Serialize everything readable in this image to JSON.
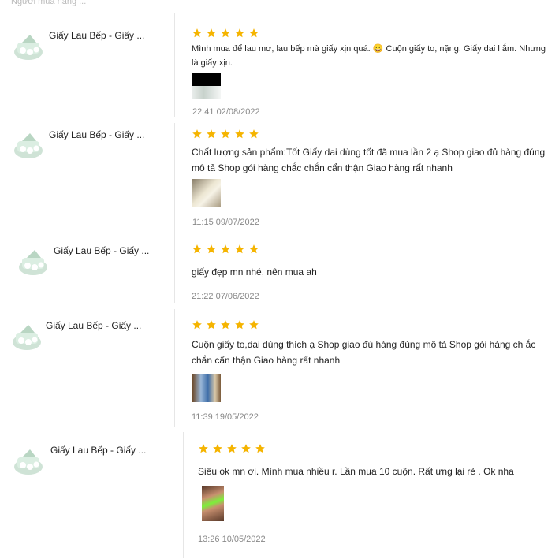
{
  "header": {
    "faded_text": "Người mua hàng ..."
  },
  "reviews": [
    {
      "product": "Giấy Lau Bếp - Giấy ...",
      "rating": 5,
      "text": "Mình mua để lau mơ, lau bếp mà giấy xịn quá. 😀 Cuộn giấy to, nặng. Giấy dai l ắm. Nhưng là giấy xịn.",
      "time": "22:41 02/08/2022"
    },
    {
      "product": "Giấy Lau Bếp - Giấy ...",
      "rating": 5,
      "text": "Chất lượng sản phẩm:Tốt Giấy dai dùng tốt đã mua lần 2 ạ Shop giao đủ hàng đúng mô tả Shop gói hàng chắc chắn cẩn thận Giao hàng rất nhanh",
      "time": "11:15 09/07/2022"
    },
    {
      "product": "Giấy Lau Bếp - Giấy ...",
      "rating": 5,
      "text": "giấy đẹp mn nhé, nên mua ah",
      "time": "21:22 07/06/2022"
    },
    {
      "product": "Giấy Lau Bếp - Giấy ...",
      "rating": 5,
      "text": "Cuộn giấy to,dai dùng thích ạ Shop giao đủ hàng đúng mô tả Shop gói hàng ch ắc chắn cẩn thận Giao hàng rất nhanh",
      "time": "11:39 19/05/2022"
    },
    {
      "product": "Giấy Lau Bếp - Giấy ...",
      "rating": 5,
      "text": "Siêu ok mn ơi. Mình mua nhiều r. Lần mua 10 cuộn. Rất ưng lại rẻ . Ok nha",
      "time": "13:26 10/05/2022"
    }
  ],
  "colors": {
    "star": "#f5b400",
    "avatar": "#cfe3d6",
    "time": "#888888"
  },
  "icons": {
    "avatar": "paper-towel-product-icon",
    "star": "star-icon"
  }
}
